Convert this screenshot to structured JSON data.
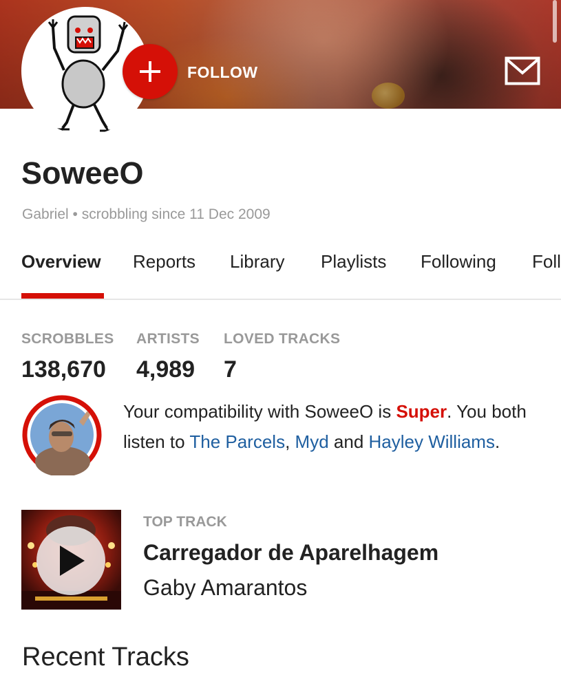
{
  "header": {
    "follow_label": "FOLLOW",
    "follow_icon": "plus-icon",
    "message_icon": "envelope-icon",
    "accent_color": "#d51007"
  },
  "profile": {
    "username": "SoweeO",
    "real_name": "Gabriel",
    "separator": "•",
    "since_text": "scrobbling since 11 Dec 2009"
  },
  "tabs": [
    {
      "label": "Overview",
      "active": true
    },
    {
      "label": "Reports",
      "active": false
    },
    {
      "label": "Library",
      "active": false
    },
    {
      "label": "Playlists",
      "active": false
    },
    {
      "label": "Following",
      "active": false
    },
    {
      "label": "Foll",
      "active": false
    }
  ],
  "stats": [
    {
      "label": "SCROBBLES",
      "value": "138,670"
    },
    {
      "label": "ARTISTS",
      "value": "4,989"
    },
    {
      "label": "LOVED TRACKS",
      "value": "7"
    }
  ],
  "compatibility": {
    "prefix": "Your compatibility with SoweeO is ",
    "level": "Super",
    "middle": ". You both listen to ",
    "artist_1": "The Parcels",
    "sep_1": ", ",
    "artist_2": "Myd",
    "sep_2": " and ",
    "artist_3": "Hayley Williams",
    "suffix": ".",
    "level_color": "#d51007",
    "link_color": "#1f5fa0"
  },
  "top_track": {
    "label": "TOP TRACK",
    "name": "Carregador de Aparelhagem",
    "artist": "Gaby Amarantos",
    "play_icon": "play-icon"
  },
  "recent": {
    "title": "Recent Tracks"
  }
}
